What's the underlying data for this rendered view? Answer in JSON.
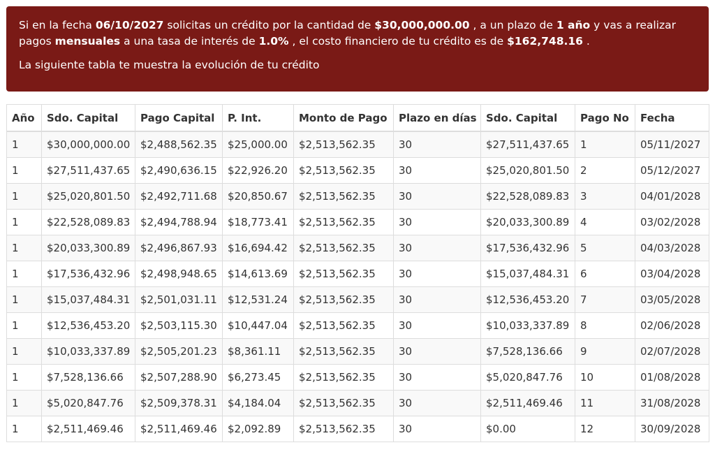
{
  "summary": {
    "t1": "Si en la fecha ",
    "date": "06/10/2027",
    "t2": " solicitas un crédito por la cantidad de ",
    "amount": "$30,000,000.00",
    "t3": " , a un plazo de ",
    "term": "1 año",
    "t4": " y vas a realizar pagos ",
    "frequency": "mensuales",
    "t5": " a una tasa de interés de ",
    "rate": "1.0%",
    "t6": " , el costo financiero de tu crédito es de ",
    "cost": "$162,748.16",
    "t7": " .",
    "subtitle": "La siguiente tabla te muestra la evolución de tu crédito"
  },
  "table": {
    "headers": [
      "Año",
      "Sdo. Capital",
      "Pago Capital",
      "P. Int.",
      "Monto de Pago",
      "Plazo en días",
      "Sdo. Capital",
      "Pago No",
      "Fecha"
    ],
    "rows": [
      [
        "1",
        "$30,000,000.00",
        "$2,488,562.35",
        "$25,000.00",
        "$2,513,562.35",
        "30",
        "$27,511,437.65",
        "1",
        "05/11/2027"
      ],
      [
        "1",
        "$27,511,437.65",
        "$2,490,636.15",
        "$22,926.20",
        "$2,513,562.35",
        "30",
        "$25,020,801.50",
        "2",
        "05/12/2027"
      ],
      [
        "1",
        "$25,020,801.50",
        "$2,492,711.68",
        "$20,850.67",
        "$2,513,562.35",
        "30",
        "$22,528,089.83",
        "3",
        "04/01/2028"
      ],
      [
        "1",
        "$22,528,089.83",
        "$2,494,788.94",
        "$18,773.41",
        "$2,513,562.35",
        "30",
        "$20,033,300.89",
        "4",
        "03/02/2028"
      ],
      [
        "1",
        "$20,033,300.89",
        "$2,496,867.93",
        "$16,694.42",
        "$2,513,562.35",
        "30",
        "$17,536,432.96",
        "5",
        "04/03/2028"
      ],
      [
        "1",
        "$17,536,432.96",
        "$2,498,948.65",
        "$14,613.69",
        "$2,513,562.35",
        "30",
        "$15,037,484.31",
        "6",
        "03/04/2028"
      ],
      [
        "1",
        "$15,037,484.31",
        "$2,501,031.11",
        "$12,531.24",
        "$2,513,562.35",
        "30",
        "$12,536,453.20",
        "7",
        "03/05/2028"
      ],
      [
        "1",
        "$12,536,453.20",
        "$2,503,115.30",
        "$10,447.04",
        "$2,513,562.35",
        "30",
        "$10,033,337.89",
        "8",
        "02/06/2028"
      ],
      [
        "1",
        "$10,033,337.89",
        "$2,505,201.23",
        "$8,361.11",
        "$2,513,562.35",
        "30",
        "$7,528,136.66",
        "9",
        "02/07/2028"
      ],
      [
        "1",
        "$7,528,136.66",
        "$2,507,288.90",
        "$6,273.45",
        "$2,513,562.35",
        "30",
        "$5,020,847.76",
        "10",
        "01/08/2028"
      ],
      [
        "1",
        "$5,020,847.76",
        "$2,509,378.31",
        "$4,184.04",
        "$2,513,562.35",
        "30",
        "$2,511,469.46",
        "11",
        "31/08/2028"
      ],
      [
        "1",
        "$2,511,469.46",
        "$2,511,469.46",
        "$2,092.89",
        "$2,513,562.35",
        "30",
        "$0.00",
        "12",
        "30/09/2028"
      ]
    ]
  },
  "colors": {
    "banner_background": "#7a1a16",
    "banner_text": "#ffffff",
    "table_border": "#dddddd",
    "stripe": "#f9f9f9"
  }
}
